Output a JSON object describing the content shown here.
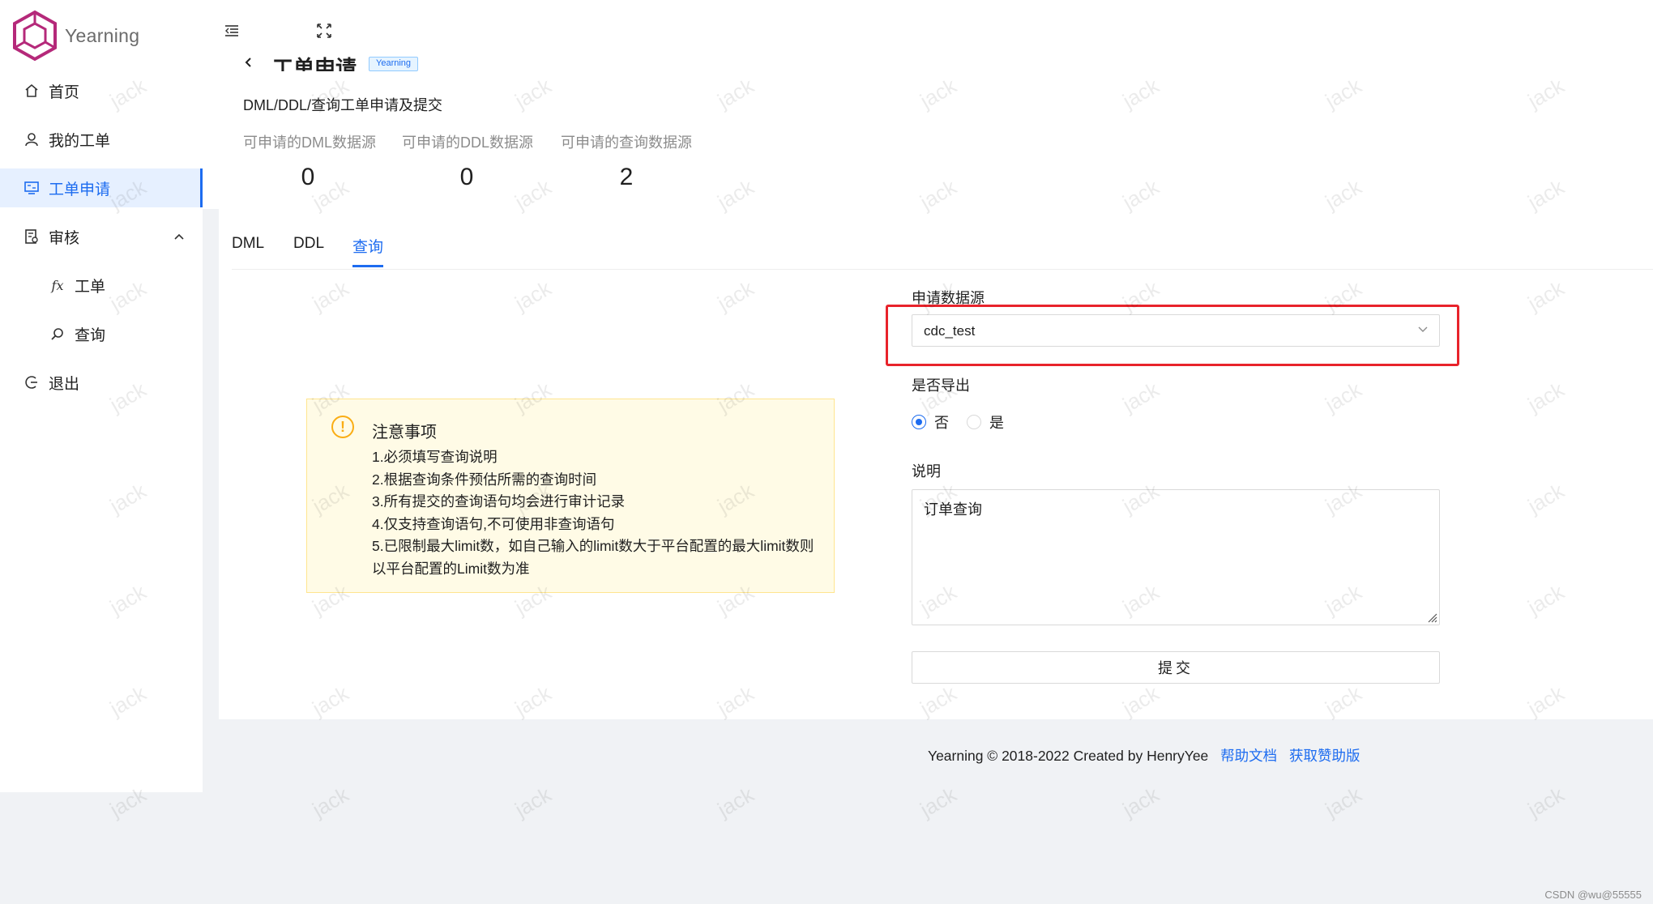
{
  "app": {
    "name": "Yearning",
    "accent": "#1d6cf0"
  },
  "sidebar": {
    "items": [
      {
        "label": "首页",
        "icon": "home-icon"
      },
      {
        "label": "我的工单",
        "icon": "user-icon"
      },
      {
        "label": "工单申请",
        "icon": "monitor-icon",
        "active": true
      },
      {
        "label": "审核",
        "icon": "audit-icon",
        "expanded": true
      },
      {
        "label": "工单",
        "icon": "function-icon",
        "sub": true
      },
      {
        "label": "查询",
        "icon": "search-icon",
        "sub": true
      },
      {
        "label": "退出",
        "icon": "logout-icon"
      }
    ]
  },
  "page_header": {
    "title": "工单申请",
    "tag": "Yearning",
    "subtitle": "DML/DDL/查询工单申请及提交",
    "stats": [
      {
        "label": "可申请的DML数据源",
        "value": "0"
      },
      {
        "label": "可申请的DDL数据源",
        "value": "0"
      },
      {
        "label": "可申请的查询数据源",
        "value": "2"
      }
    ]
  },
  "tabs": [
    {
      "label": "DML"
    },
    {
      "label": "DDL"
    },
    {
      "label": "查询",
      "active": true
    }
  ],
  "notice": {
    "title": "注意事项",
    "lines": [
      "1.必须填写查询说明",
      "2.根据查询条件预估所需的查询时间",
      "3.所有提交的查询语句均会进行审计记录",
      "4.仅支持查询语句,不可使用非查询语句",
      "5.已限制最大limit数，如自己输入的limit数大于平台配置的最大limit数则以平台配置的Limit数为准"
    ]
  },
  "form": {
    "datasource_label": "申请数据源",
    "datasource_value": "cdc_test",
    "export_label": "是否导出",
    "export_options": [
      "否",
      "是"
    ],
    "export_selected": "否",
    "desc_label": "说明",
    "desc_value": "订单查询",
    "submit_label": "提交"
  },
  "footer": {
    "copyright": "Yearning © 2018-2022 Created by HenryYee",
    "help_link": "帮助文档",
    "sponsor_link": "获取赞助版"
  },
  "watermark": "jack",
  "csdn_credit": "CSDN @wu@55555",
  "highlight_color": "#e8232b"
}
